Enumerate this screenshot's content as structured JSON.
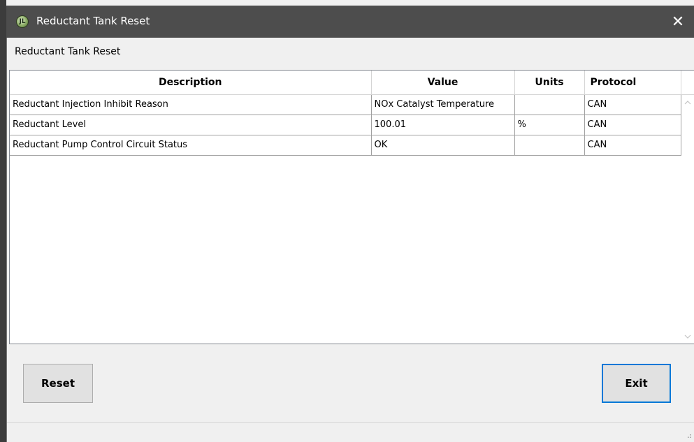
{
  "window": {
    "title": "Reductant Tank Reset",
    "icon": "app-logo-icon",
    "close_glyph": "✕",
    "app_icon_glyph": "JL"
  },
  "heading": "Reductant Tank Reset",
  "table": {
    "columns": [
      "Description",
      "Value",
      "Units",
      "Protocol"
    ],
    "rows": [
      {
        "description": "Reductant Injection Inhibit Reason",
        "value": "NOx Catalyst Temperature",
        "units": "",
        "protocol": "CAN"
      },
      {
        "description": "Reductant Level",
        "value": "100.01",
        "units": "%",
        "protocol": "CAN"
      },
      {
        "description": "Reductant Pump Control Circuit Status",
        "value": "OK",
        "units": "",
        "protocol": "CAN"
      }
    ]
  },
  "buttons": {
    "reset": "Reset",
    "exit": "Exit"
  },
  "colors": {
    "titlebar": "#4d4d4d",
    "focus_border": "#0078d7"
  }
}
